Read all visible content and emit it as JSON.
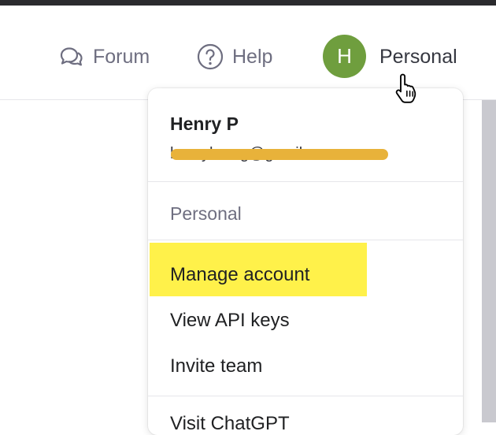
{
  "header": {
    "forum_label": "Forum",
    "help_label": "Help",
    "avatar_initial": "H",
    "account_label": "Personal",
    "icons": {
      "forum": "chat-bubbles-icon",
      "help": "question-circle-icon"
    }
  },
  "menu": {
    "user_name": "Henry P",
    "user_email": "henryhmng@gmail.com",
    "section_label": "Personal",
    "items": [
      {
        "label": "Manage account",
        "highlighted": true
      },
      {
        "label": "View API keys"
      },
      {
        "label": "Invite team"
      },
      {
        "label": "Visit ChatGPT"
      }
    ]
  },
  "colors": {
    "avatar": "#6f9e3e",
    "highlight": "#fff14a",
    "redaction": "#e8b23a",
    "muted_text": "#6e6e80"
  }
}
